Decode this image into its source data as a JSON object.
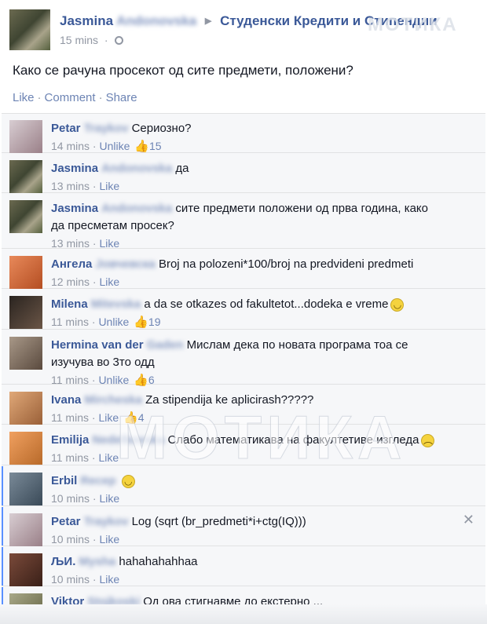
{
  "post": {
    "author_first": "Jasmina",
    "author_last": "Andonovska",
    "group": "Студенски Кредити и Стипендии",
    "time": "15 mins",
    "text": "Како се рачуна просекот од сите предмети, положени?",
    "actions": [
      "Like",
      "Comment",
      "Share"
    ]
  },
  "watermark": "МОТИКА",
  "comments": [
    {
      "first": "Petar",
      "last": "Traykov",
      "text": "Сериозно?",
      "time": "14 mins",
      "action": "Unlike",
      "likes": "15",
      "avatar": "#b8a9b0"
    },
    {
      "first": "Jasmina",
      "last": "Andonovska",
      "text": "да",
      "time": "13 mins",
      "action": "Like",
      "likes": "",
      "avatar": "#6b6a50"
    },
    {
      "first": "Jasmina",
      "last": "Andonovska",
      "text": "сите предмети положени од прва година, како да пресметам просек?",
      "time": "13 mins",
      "action": "Like",
      "likes": "",
      "avatar": "#6b6a50"
    },
    {
      "first": "Ангела",
      "last": "Јовчевска",
      "text": "Broj na polozeni*100/broj na predvideni predmeti",
      "time": "12 mins",
      "action": "Like",
      "likes": "",
      "avatar": "#d06a3a"
    },
    {
      "first": "Milena",
      "last": "Mitevska",
      "text": "a da se otkazes od fakultetot...dodeka e vreme",
      "time": "11 mins",
      "action": "Unlike",
      "likes": "19",
      "avatar": "#4a3d33",
      "emoji": "smile"
    },
    {
      "first": "Hermina van der",
      "last": "Gaden",
      "text": "Мислам дека по новата програма тоа се изучува во 3то одд",
      "time": "11 mins",
      "action": "Unlike",
      "likes": "6",
      "avatar": "#8a7a6a"
    },
    {
      "first": "Ivana",
      "last": "Mircheska",
      "text": "Za stipendija ke aplicirash?????",
      "time": "11 mins",
      "action": "Like",
      "likes": "4",
      "avatar": "#c98a5a"
    },
    {
      "first": "Emilija",
      "last": "Nedelkovska",
      "text": "Слабо математикава на факултетиве изгледа",
      "time": "11 mins",
      "action": "Like",
      "likes": "",
      "avatar": "#d88a4a",
      "emoji": "sad"
    },
    {
      "first": "Erbil",
      "last": "Recep",
      "text": "",
      "time": "10 mins",
      "action": "Like",
      "likes": "",
      "avatar": "#5a6a78",
      "emoji": "smile"
    },
    {
      "first": "Petar",
      "last": "Traykov",
      "text": "Log (sqrt (br_predmeti*i+ctg(IQ)))",
      "time": "10 mins",
      "action": "Like",
      "likes": "",
      "avatar": "#b8a9b0"
    },
    {
      "first": "ЉИ.",
      "last": "Mysha",
      "text": "hahahahahhaa",
      "time": "10 mins",
      "action": "Like",
      "likes": "",
      "avatar": "#5a3a2a"
    },
    {
      "first": "Viktor",
      "last": "Stojkoski",
      "text": "Од ова стигнавме до екстерно ...",
      "time": "",
      "action": "",
      "likes": "",
      "avatar": "#8a8a6a"
    }
  ]
}
